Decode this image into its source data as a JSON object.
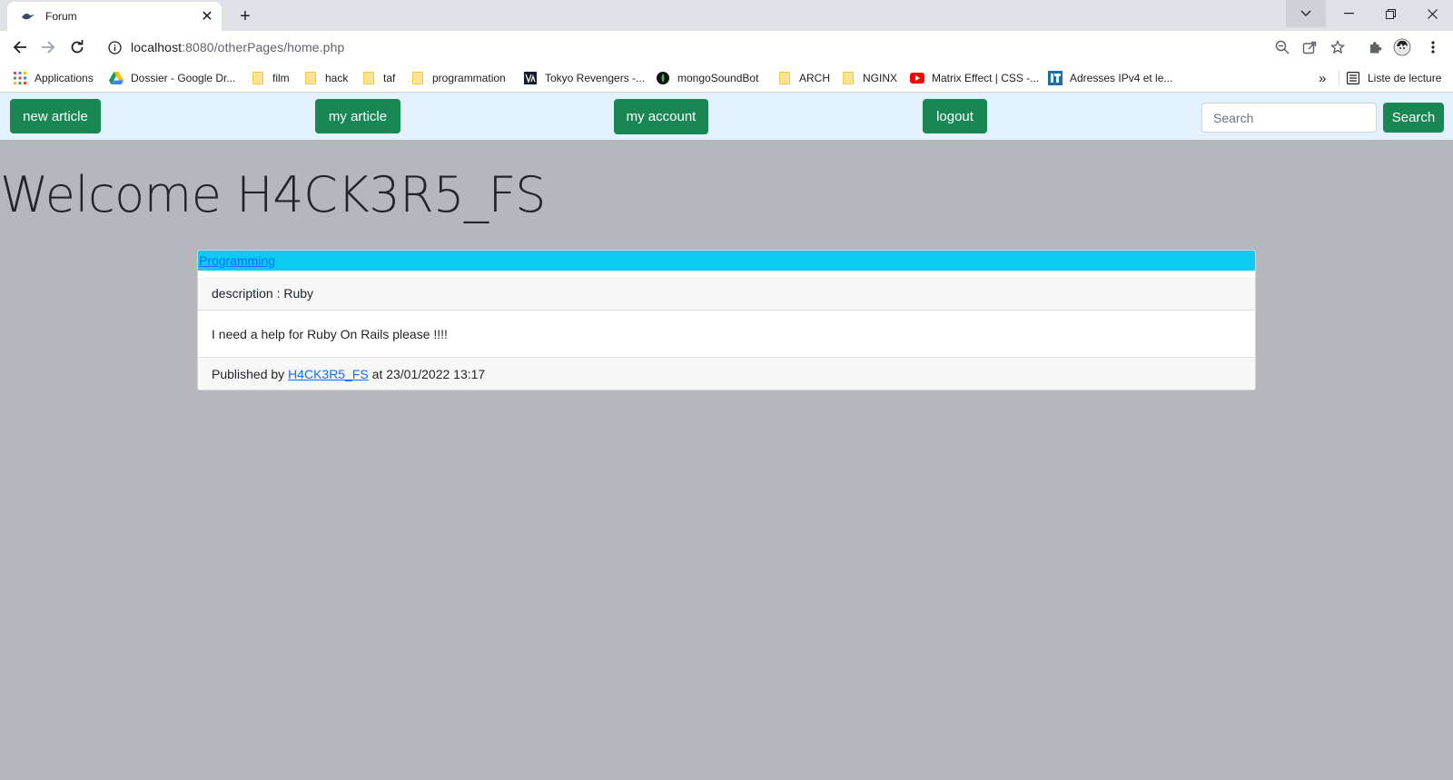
{
  "browser": {
    "tab_title": "Forum",
    "url_host": "localhost",
    "url_rest": ":8080/otherPages/home.php",
    "bookmarks": [
      {
        "label": "Applications",
        "icon": "apps-grid-icon"
      },
      {
        "label": "Dossier - Google Dr...",
        "icon": "google-drive-icon"
      },
      {
        "label": "film",
        "icon": "folder-icon"
      },
      {
        "label": "hack",
        "icon": "folder-icon"
      },
      {
        "label": "taf",
        "icon": "folder-icon"
      },
      {
        "label": "programmation",
        "icon": "folder-icon"
      },
      {
        "label": "Tokyo Revengers -...",
        "icon": "site-icon"
      },
      {
        "label": "mongoSoundBot",
        "icon": "mongodb-icon"
      },
      {
        "label": "ARCH",
        "icon": "folder-icon"
      },
      {
        "label": "NGINX",
        "icon": "folder-icon"
      },
      {
        "label": "Matrix Effect | CSS -...",
        "icon": "youtube-icon"
      },
      {
        "label": "Adresses IPv4 et le...",
        "icon": "it-icon"
      }
    ],
    "overflow_label": "»",
    "reading_list_label": "Liste de lecture"
  },
  "nav": {
    "new_article": "new article",
    "my_article": "my article",
    "my_account": "my account",
    "logout": "logout",
    "search_placeholder": "Search",
    "search_button": "Search"
  },
  "welcome": "Welcome H4CK3R5_FS",
  "article": {
    "category": "Programming",
    "description": "description : Ruby",
    "body": "I need a help for Ruby On Rails please !!!!",
    "published_prefix": "Published by ",
    "author": "H4CK3R5_FS",
    "published_suffix": " at 23/01/2022 13:17"
  },
  "colors": {
    "nav_bg": "#e3f1fc",
    "button_green": "#198754",
    "page_bg": "#b6b7bc",
    "category_bg": "#0dcaf0",
    "link": "#0d6efd"
  }
}
